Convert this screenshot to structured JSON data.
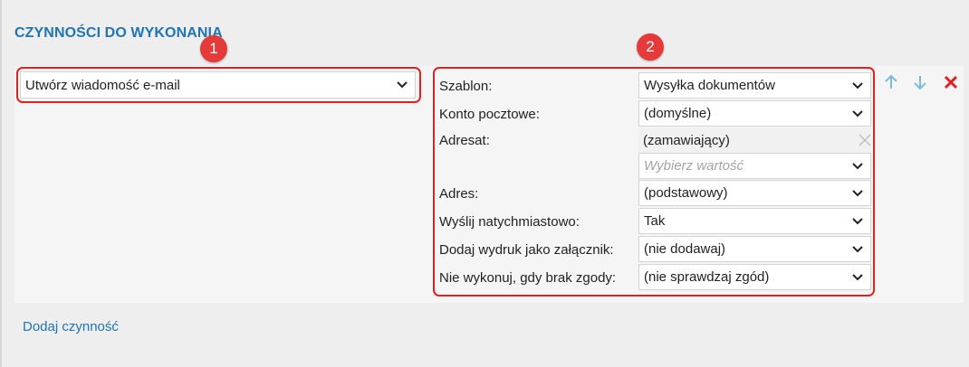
{
  "section_title": "CZYNNOŚCI DO WYKONANIA",
  "badges": [
    "1",
    "2"
  ],
  "action_select": {
    "value": "Utwórz wiadomość e-mail"
  },
  "fields": {
    "template": {
      "label": "Szablon:",
      "value": "Wysyłka dokumentów"
    },
    "mail_account": {
      "label": "Konto pocztowe:",
      "value": "(domyślne)"
    },
    "recipient": {
      "label": "Adresat:",
      "value": "(zamawiający)",
      "placeholder": "Wybierz wartość"
    },
    "address": {
      "label": "Adres:",
      "value": "(podstawowy)"
    },
    "send_immediately": {
      "label": "Wyślij natychmiastowo:",
      "value": "Tak"
    },
    "attach_printout": {
      "label": "Dodaj wydruk jako załącznik:",
      "value": "(nie dodawaj)"
    },
    "consent_check": {
      "label": "Nie wykonuj, gdy brak zgody:",
      "value": "(nie sprawdzaj zgód)"
    }
  },
  "add_action_link": "Dodaj czynność",
  "icons": {
    "move_up": "arrow-up-icon",
    "move_down": "arrow-down-icon",
    "delete": "close-icon",
    "chevron": "chevron-down-icon"
  },
  "colors": {
    "accent": "#1f74b4",
    "highlight": "#e32020",
    "badge": "#e53a3a",
    "arrow": "#7fb8dd",
    "delete": "#e02020"
  }
}
